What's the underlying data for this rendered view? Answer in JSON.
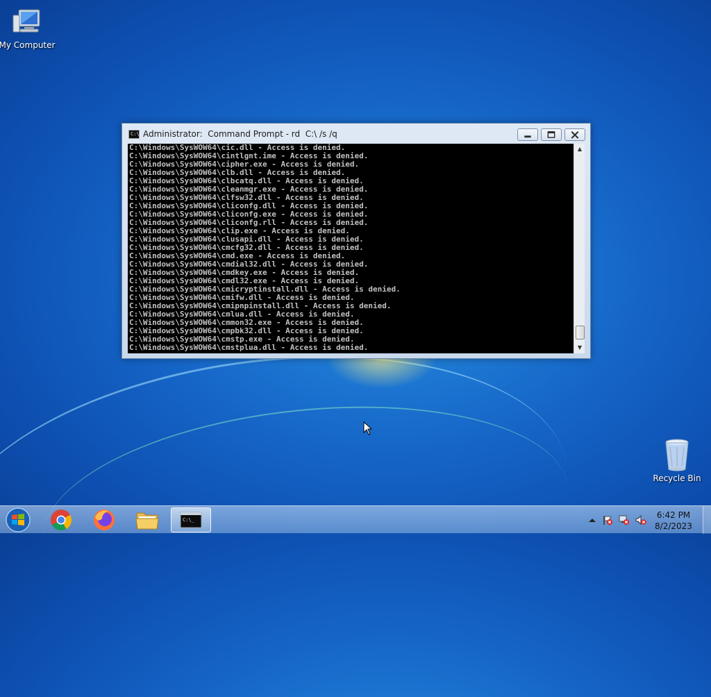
{
  "desktop": {
    "icons": [
      {
        "label": "My Computer",
        "icon": "computer-icon"
      },
      {
        "label": "Recycle Bin",
        "icon": "recycle-bin-icon"
      }
    ]
  },
  "window": {
    "title": "Administrator:  Command Prompt - rd  C:\\ /s /q",
    "icon": "cmd-icon",
    "lines": [
      "C:\\Windows\\SysWOW64\\cic.dll - Access is denied.",
      "C:\\Windows\\SysWOW64\\cintlgnt.ime - Access is denied.",
      "C:\\Windows\\SysWOW64\\cipher.exe - Access is denied.",
      "C:\\Windows\\SysWOW64\\clb.dll - Access is denied.",
      "C:\\Windows\\SysWOW64\\clbcatq.dll - Access is denied.",
      "C:\\Windows\\SysWOW64\\cleanmgr.exe - Access is denied.",
      "C:\\Windows\\SysWOW64\\clfsw32.dll - Access is denied.",
      "C:\\Windows\\SysWOW64\\cliconfg.dll - Access is denied.",
      "C:\\Windows\\SysWOW64\\cliconfg.exe - Access is denied.",
      "C:\\Windows\\SysWOW64\\cliconfg.rll - Access is denied.",
      "C:\\Windows\\SysWOW64\\clip.exe - Access is denied.",
      "C:\\Windows\\SysWOW64\\clusapi.dll - Access is denied.",
      "C:\\Windows\\SysWOW64\\cmcfg32.dll - Access is denied.",
      "C:\\Windows\\SysWOW64\\cmd.exe - Access is denied.",
      "C:\\Windows\\SysWOW64\\cmdial32.dll - Access is denied.",
      "C:\\Windows\\SysWOW64\\cmdkey.exe - Access is denied.",
      "C:\\Windows\\SysWOW64\\cmdl32.exe - Access is denied.",
      "C:\\Windows\\SysWOW64\\cmicryptinstall.dll - Access is denied.",
      "C:\\Windows\\SysWOW64\\cmifw.dll - Access is denied.",
      "C:\\Windows\\SysWOW64\\cmipnpinstall.dll - Access is denied.",
      "C:\\Windows\\SysWOW64\\cmlua.dll - Access is denied.",
      "C:\\Windows\\SysWOW64\\cmmon32.exe - Access is denied.",
      "C:\\Windows\\SysWOW64\\cmpbk32.dll - Access is denied.",
      "C:\\Windows\\SysWOW64\\cmstp.exe - Access is denied.",
      "C:\\Windows\\SysWOW64\\cmstplua.dll - Access is denied."
    ]
  },
  "taskbar": {
    "start_icon": "windows-start-icon",
    "pinned": [
      {
        "name": "chrome",
        "icon": "chrome-icon"
      },
      {
        "name": "firefox",
        "icon": "firefox-icon"
      },
      {
        "name": "explorer",
        "icon": "folder-icon"
      },
      {
        "name": "cmd",
        "icon": "cmd-icon"
      }
    ],
    "tray_icons": [
      "chevron-up-icon",
      "action-center-flag-icon",
      "network-icon",
      "volume-muted-icon"
    ],
    "clock": {
      "time": "6:42 PM",
      "date": "8/2/2023"
    }
  }
}
